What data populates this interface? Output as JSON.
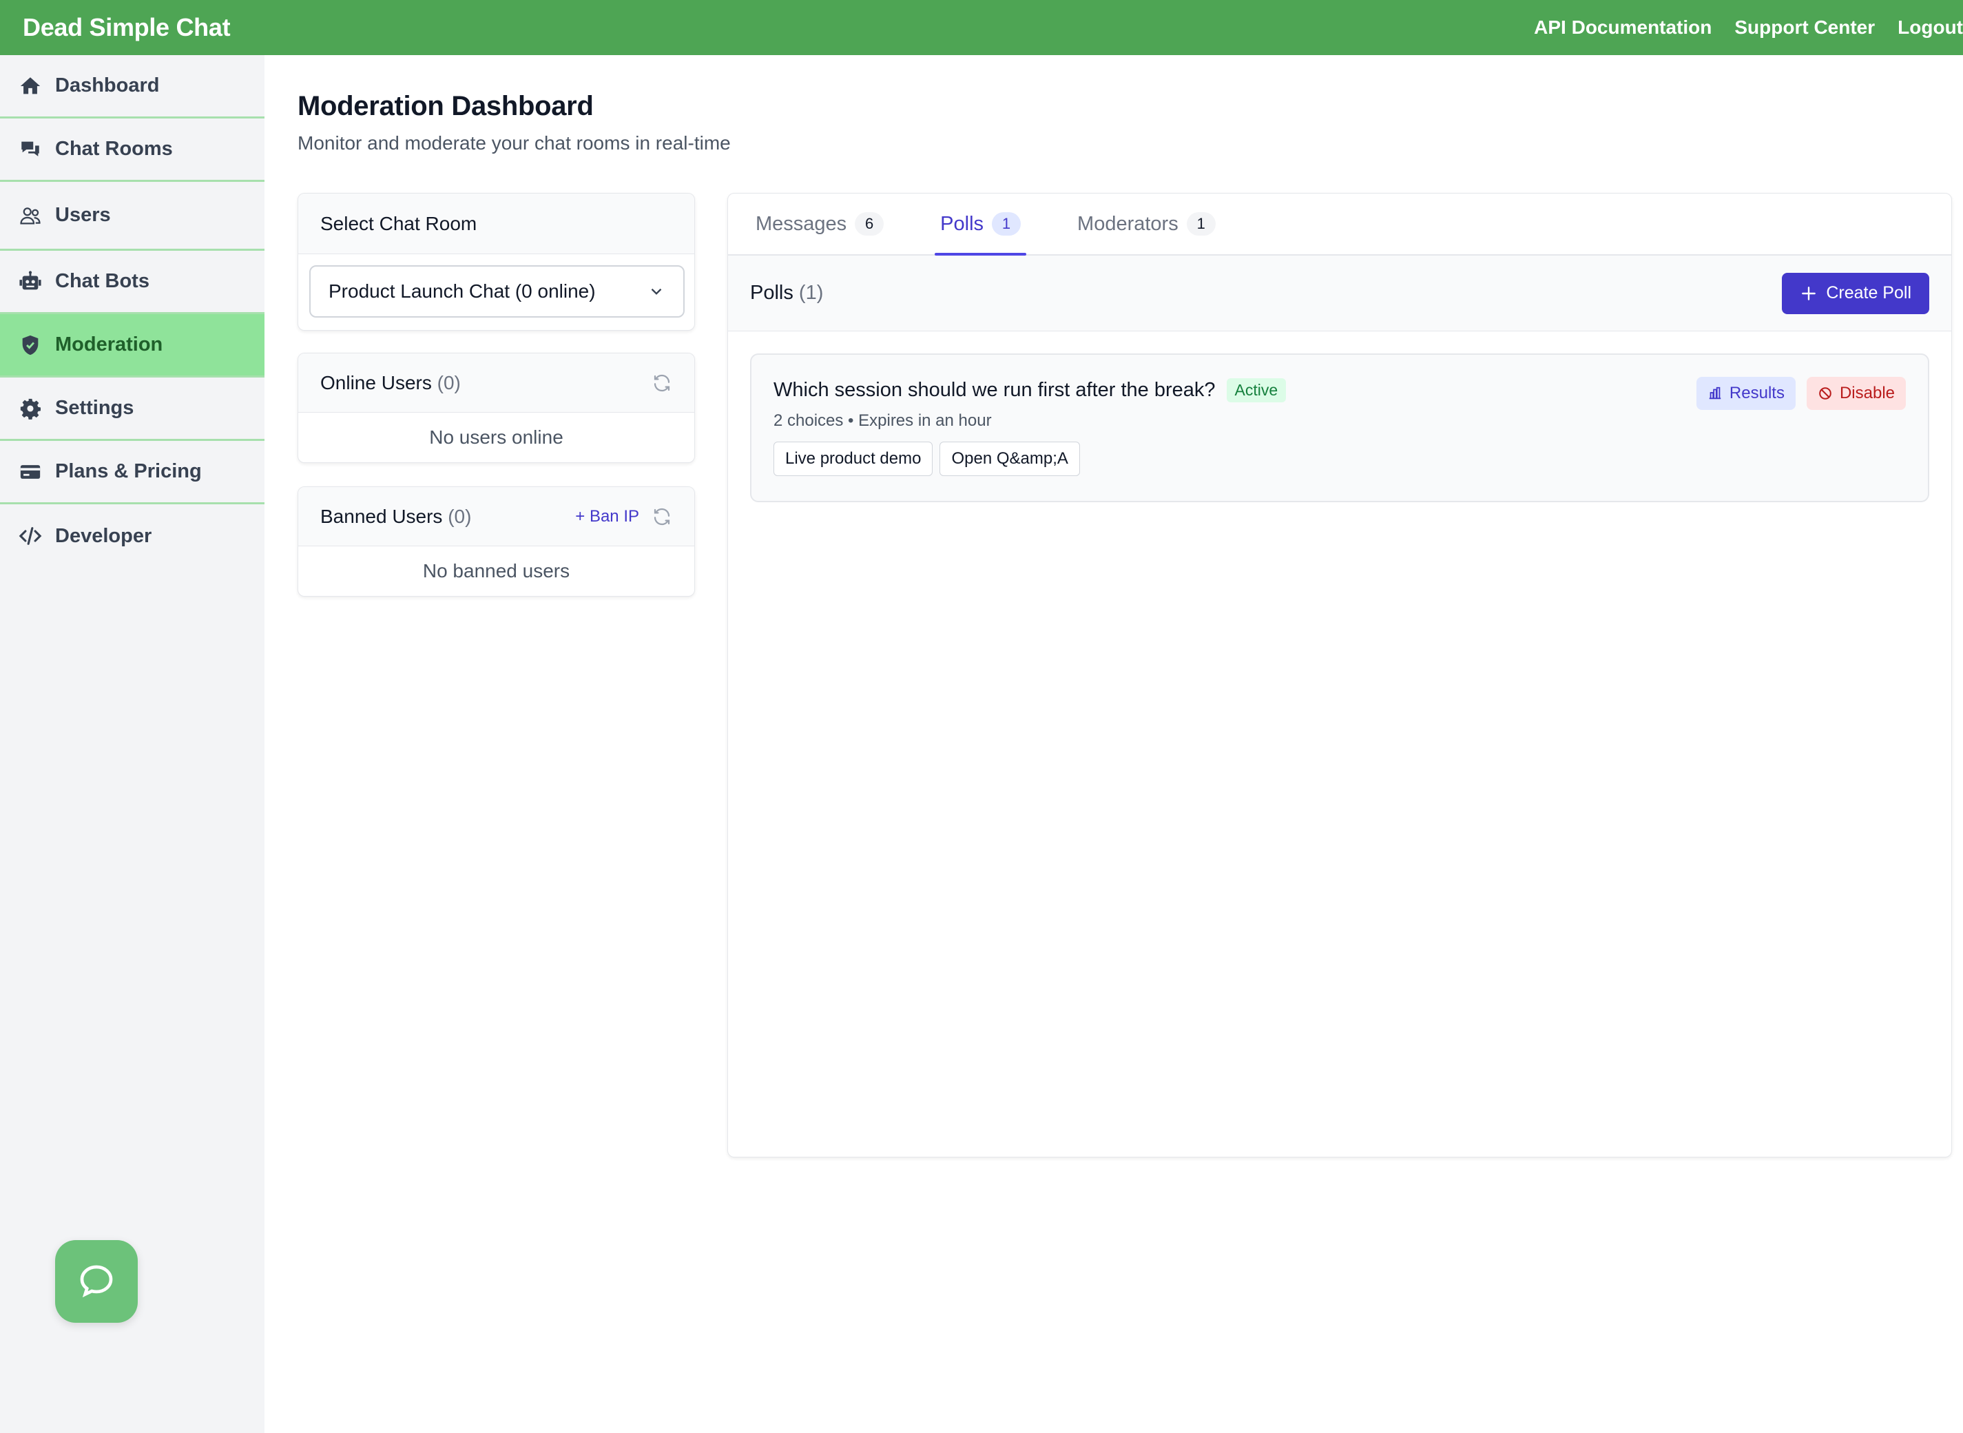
{
  "header": {
    "brand": "Dead Simple Chat",
    "links": [
      "API Documentation",
      "Support Center",
      "Logout"
    ]
  },
  "sidebar": {
    "items": [
      {
        "label": "Dashboard",
        "icon": "home-icon"
      },
      {
        "label": "Chat Rooms",
        "icon": "chat-rooms-icon"
      },
      {
        "label": "Users",
        "icon": "users-icon"
      },
      {
        "label": "Chat Bots",
        "icon": "robot-icon"
      },
      {
        "label": "Moderation",
        "icon": "shield-icon",
        "active": true
      },
      {
        "label": "Settings",
        "icon": "gear-icon"
      },
      {
        "label": "Plans & Pricing",
        "icon": "credit-card-icon"
      },
      {
        "label": "Developer",
        "icon": "code-icon"
      }
    ]
  },
  "page": {
    "title": "Moderation Dashboard",
    "subtitle": "Monitor and moderate your chat rooms in real-time"
  },
  "select_room": {
    "title": "Select Chat Room",
    "selected": "Product Launch Chat (0 online)"
  },
  "online_users": {
    "title": "Online Users",
    "count": "(0)",
    "empty": "No users online"
  },
  "banned_users": {
    "title": "Banned Users",
    "count": "(0)",
    "ban_ip": "+ Ban IP",
    "empty": "No banned users"
  },
  "tabs": [
    {
      "label": "Messages",
      "count": "6"
    },
    {
      "label": "Polls",
      "count": "1",
      "active": true
    },
    {
      "label": "Moderators",
      "count": "1"
    }
  ],
  "polls": {
    "title": "Polls",
    "count": "(1)",
    "create_label": "Create Poll",
    "items": [
      {
        "question": "Which session should we run first after the break?",
        "status": "Active",
        "meta": "2 choices • Expires in an hour",
        "choices": [
          "Live product demo",
          "Open Q&amp;A"
        ],
        "results_label": "Results",
        "disable_label": "Disable"
      }
    ]
  },
  "colors": {
    "brand_green": "#4ea554",
    "active_nav": "#8fe39a",
    "primary": "#4338ca"
  }
}
